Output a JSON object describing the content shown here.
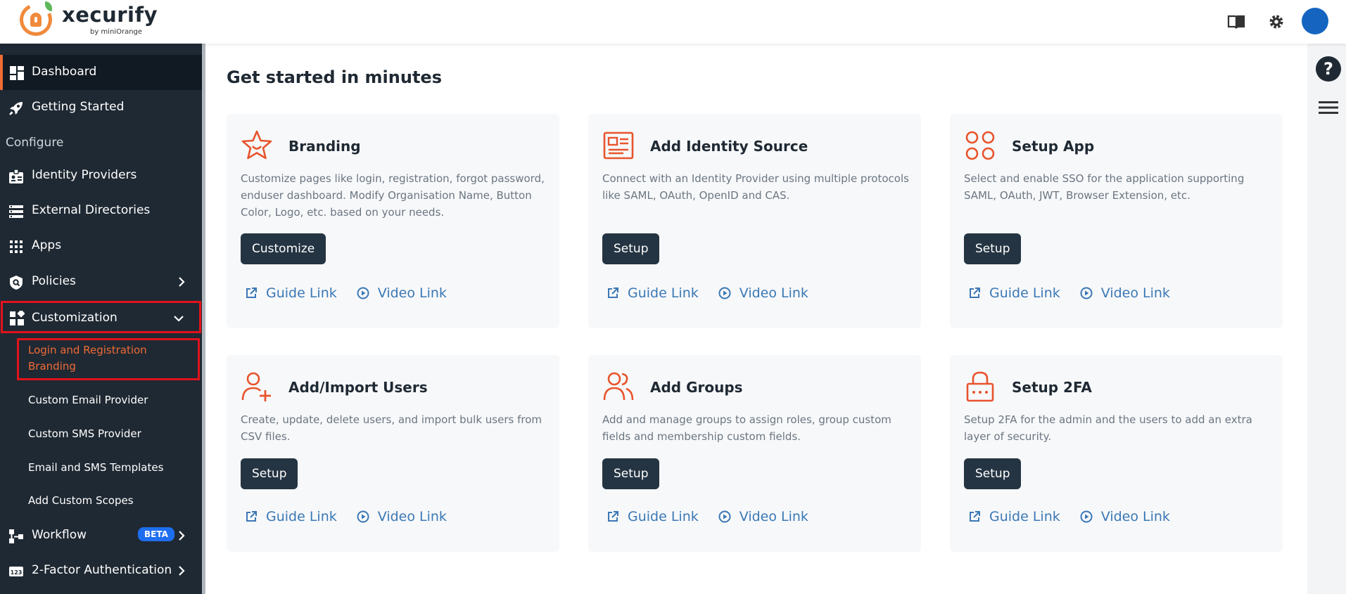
{
  "brand": {
    "name": "xecurify",
    "by": "by miniOrange"
  },
  "topbar": {
    "icons": [
      "book-icon",
      "gear-icon",
      "avatar"
    ]
  },
  "colors": {
    "accent": "#f06a35",
    "sidebar": "#1f2933",
    "button": "#243442",
    "link": "#3a78b5",
    "highlight": "#e0131c",
    "beta": "#1e6ef0"
  },
  "sidebar": {
    "dashboard": "Dashboard",
    "getting_started": "Getting Started",
    "section_configure": "Configure",
    "identity_providers": "Identity Providers",
    "external_directories": "External Directories",
    "apps": "Apps",
    "policies": "Policies",
    "customization": "Customization",
    "sub": {
      "login_branding": "Login and Registration Branding",
      "email_provider": "Custom Email Provider",
      "sms_provider": "Custom SMS Provider",
      "templates": "Email and SMS Templates",
      "scopes": "Add Custom Scopes"
    },
    "workflow": "Workflow",
    "beta": "BETA",
    "two_factor": "2-Factor Authentication"
  },
  "main": {
    "title": "Get started in minutes",
    "guide_link": "Guide Link",
    "video_link": "Video Link",
    "cards": [
      {
        "title": "Branding",
        "desc": "Customize pages like login, registration, forgot password, enduser dashboard. Modify Organisation Name, Button Color, Logo, etc. based on your needs.",
        "button": "Customize"
      },
      {
        "title": "Add Identity Source",
        "desc": "Connect with an Identity Provider using multiple protocols like SAML, OAuth, OpenID and CAS.",
        "button": "Setup"
      },
      {
        "title": "Setup App",
        "desc": "Select and enable SSO for the application supporting SAML, OAuth, JWT, Browser Extension, etc.",
        "button": "Setup"
      },
      {
        "title": "Add/Import Users",
        "desc": "Create, update, delete users, and import bulk users from CSV files.",
        "button": "Setup"
      },
      {
        "title": "Add Groups",
        "desc": "Add and manage groups to assign roles, group custom fields and membership custom fields.",
        "button": "Setup"
      },
      {
        "title": "Setup 2FA",
        "desc": "Setup 2FA for the admin and the users to add an extra layer of security.",
        "button": "Setup"
      }
    ]
  },
  "right_rail": {
    "help": "?"
  }
}
